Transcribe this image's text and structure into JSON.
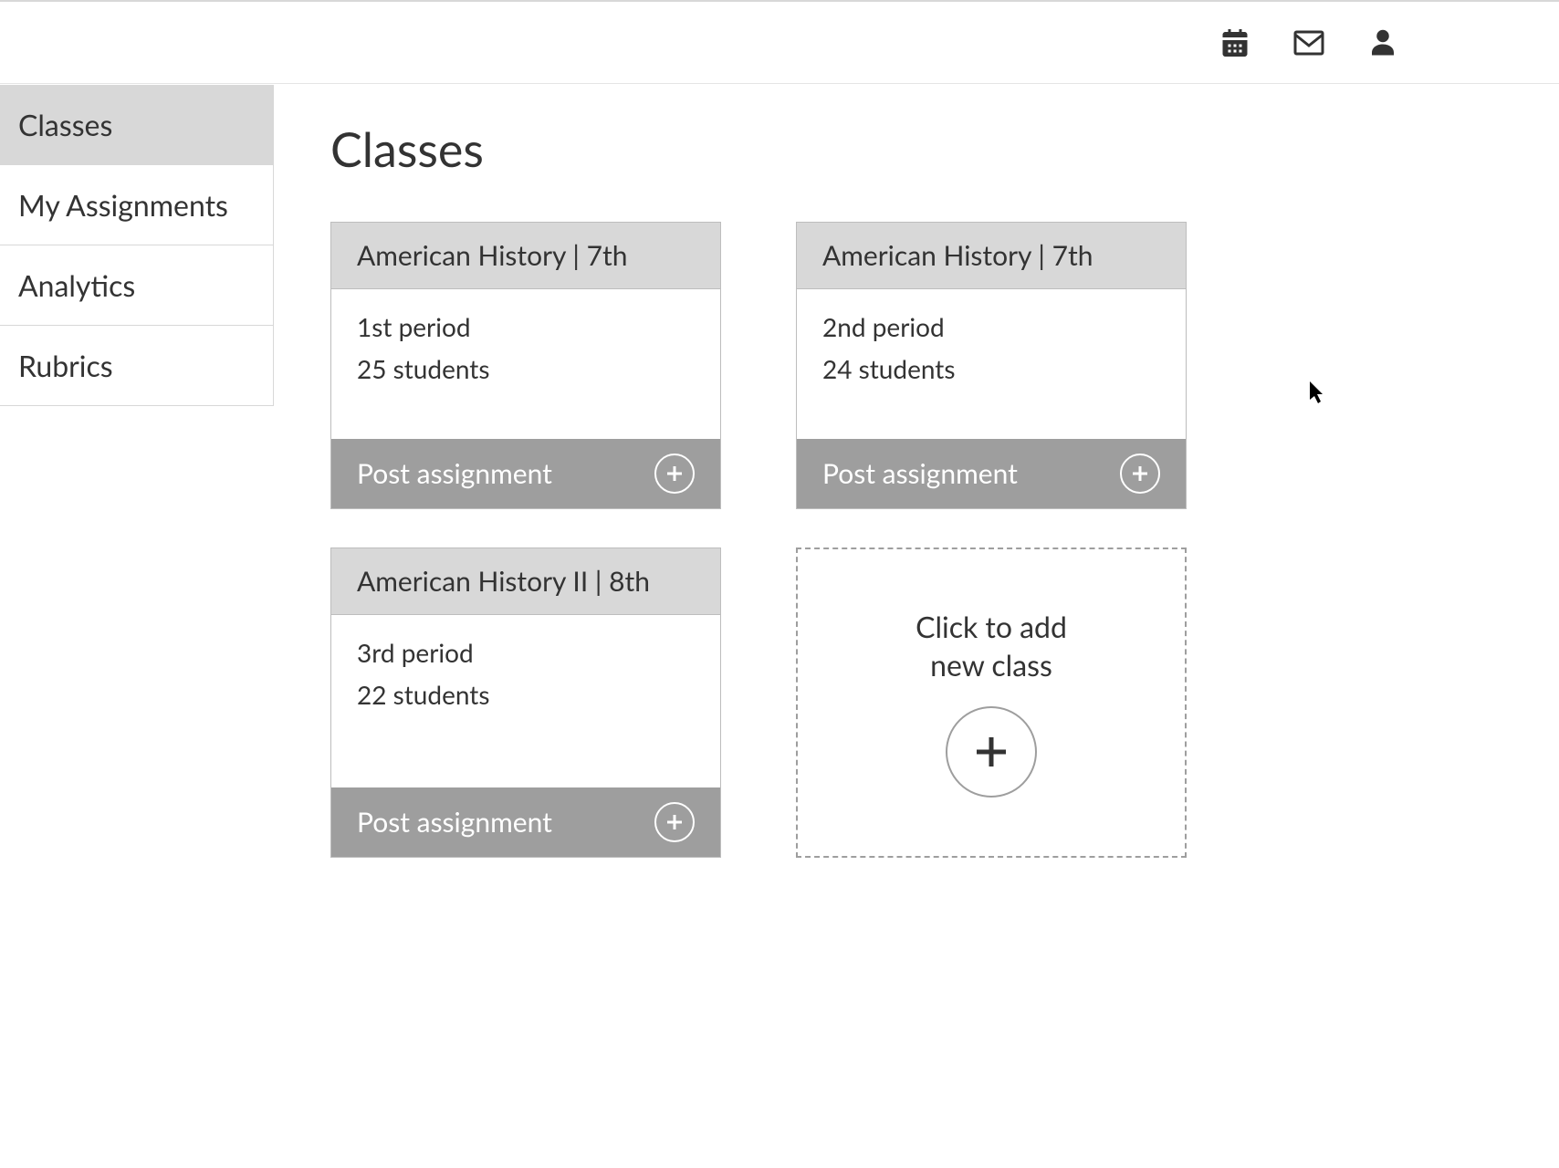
{
  "sidebar": {
    "items": [
      {
        "label": "Classes",
        "active": true
      },
      {
        "label": "My Assignments",
        "active": false
      },
      {
        "label": "Analytics",
        "active": false
      },
      {
        "label": "Rubrics",
        "active": false
      }
    ]
  },
  "page": {
    "title": "Classes"
  },
  "classes": [
    {
      "title": "American History | 7th",
      "period": "1st period",
      "students": "25 students",
      "action_label": "Post assignment"
    },
    {
      "title": "American History | 7th",
      "period": "2nd period",
      "students": "24 students",
      "action_label": "Post assignment"
    },
    {
      "title": "American History II | 8th",
      "period": "3rd period",
      "students": "22 students",
      "action_label": "Post assignment"
    }
  ],
  "add_card": {
    "text_line1": "Click to add",
    "text_line2": "new class"
  }
}
